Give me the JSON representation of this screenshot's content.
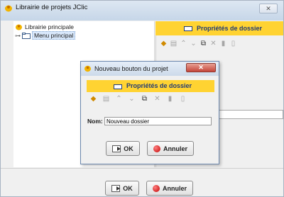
{
  "window": {
    "title": "Librairie de projets JClic",
    "close_glyph": "✕",
    "icon": "jclic-app-icon"
  },
  "tree": {
    "root_label": "Librairie principale",
    "child_label": "Menu principal"
  },
  "properties_panel": {
    "title": "Propriétés de dossier",
    "tools": [
      "add-folder-icon",
      "edit-icon",
      "up-arrow-icon",
      "down-arrow-icon",
      "copy-icon",
      "cut-icon",
      "delete-icon",
      "trash-icon"
    ]
  },
  "main_buttons": {
    "ok_label": "OK",
    "cancel_label": "Annuler"
  },
  "dialog": {
    "title": "Nouveau bouton du projet",
    "close_glyph": "✕",
    "section_title": "Propriétés de dossier",
    "name_label": "Nom:",
    "name_value": "Nouveau dossier",
    "ok_label": "OK",
    "cancel_label": "Annuler"
  },
  "colors": {
    "accent_yellow": "#ffd332",
    "title_blue": "#203a76",
    "close_red": "#c4453a"
  }
}
